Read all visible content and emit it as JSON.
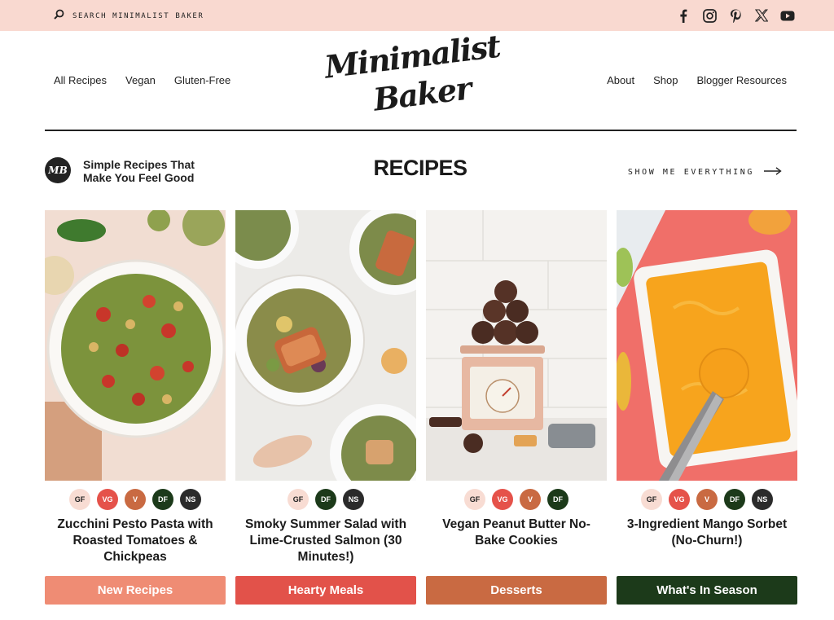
{
  "topbar": {
    "search_label": "SEARCH MINIMALIST BAKER",
    "socials": [
      "facebook-icon",
      "instagram-icon",
      "pinterest-icon",
      "x-icon",
      "youtube-icon"
    ]
  },
  "nav": {
    "left": [
      "All Recipes",
      "Vegan",
      "Gluten-Free"
    ],
    "right": [
      "About",
      "Shop",
      "Blogger Resources"
    ]
  },
  "logo": {
    "line1": "Minimalist",
    "line2": "Baker"
  },
  "section": {
    "badge": "MB",
    "tagline": "Simple Recipes That Make You Feel Good",
    "title": "RECIPES",
    "show_all": "SHOW ME EVERYTHING"
  },
  "recipes": [
    {
      "title": "Zucchini Pesto Pasta with Roasted Tomatoes & Chickpeas",
      "tags": [
        "GF",
        "VG",
        "V",
        "DF",
        "NS"
      ]
    },
    {
      "title": "Smoky Summer Salad with Lime-Crusted Salmon (30 Minutes!)",
      "tags": [
        "GF",
        "DF",
        "NS"
      ]
    },
    {
      "title": "Vegan Peanut Butter No-Bake Cookies",
      "tags": [
        "GF",
        "VG",
        "V",
        "DF"
      ]
    },
    {
      "title": "3-Ingredient Mango Sorbet (No-Churn!)",
      "tags": [
        "GF",
        "VG",
        "V",
        "DF",
        "NS"
      ]
    }
  ],
  "categories": [
    {
      "label": "New Recipes",
      "color": "#ef8c74"
    },
    {
      "label": "Hearty Meals",
      "color": "#e2524a"
    },
    {
      "label": "Desserts",
      "color": "#c96a42"
    },
    {
      "label": "What's In Season",
      "color": "#1c3a1a"
    }
  ]
}
